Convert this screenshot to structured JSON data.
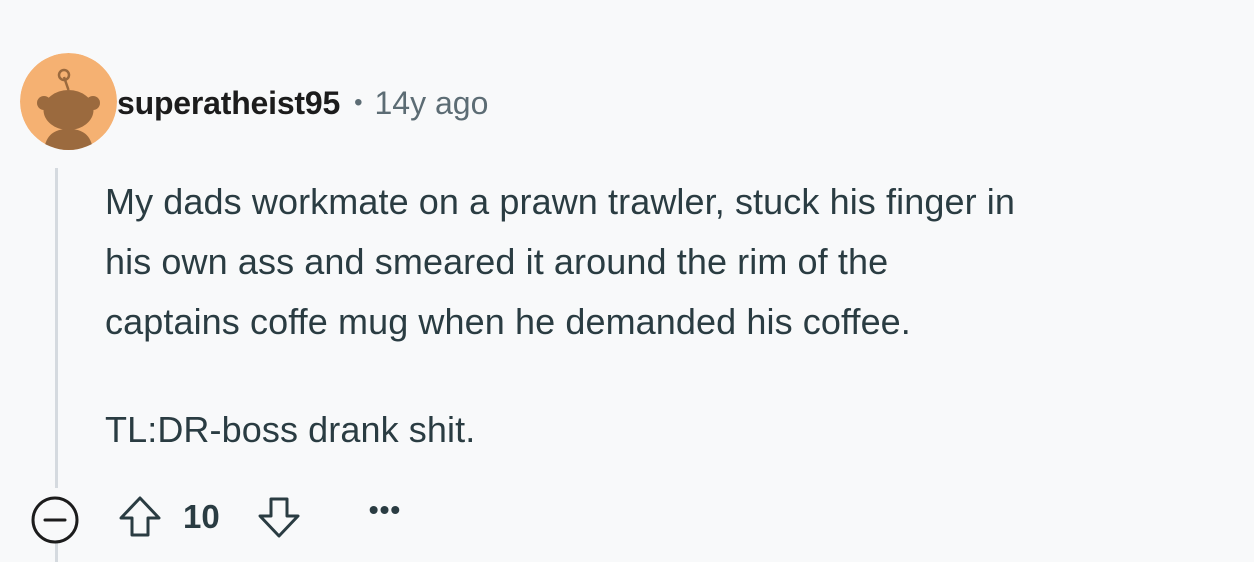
{
  "comment": {
    "username": "superatheist95",
    "separator": "•",
    "timestamp": "14y ago",
    "body_lines": [
      "My dads workmate on a prawn trawler, stuck his finger in",
      "his own ass and smeared it around the rim of the",
      "captains coffe mug when he demanded his coffee."
    ],
    "tldr": "TL:DR-boss drank shit.",
    "avatar_icon": "snoo-avatar-icon",
    "colors": {
      "avatar_bg": "#f5b172",
      "avatar_figure": "#9b6a3e",
      "text": "#2a3c42",
      "muted": "#5c6c74"
    }
  },
  "actions": {
    "collapse_icon": "minus-circle-icon",
    "upvote_icon": "arrow-up-icon",
    "score": "10",
    "downvote_icon": "arrow-down-icon",
    "more_label": "•••"
  }
}
